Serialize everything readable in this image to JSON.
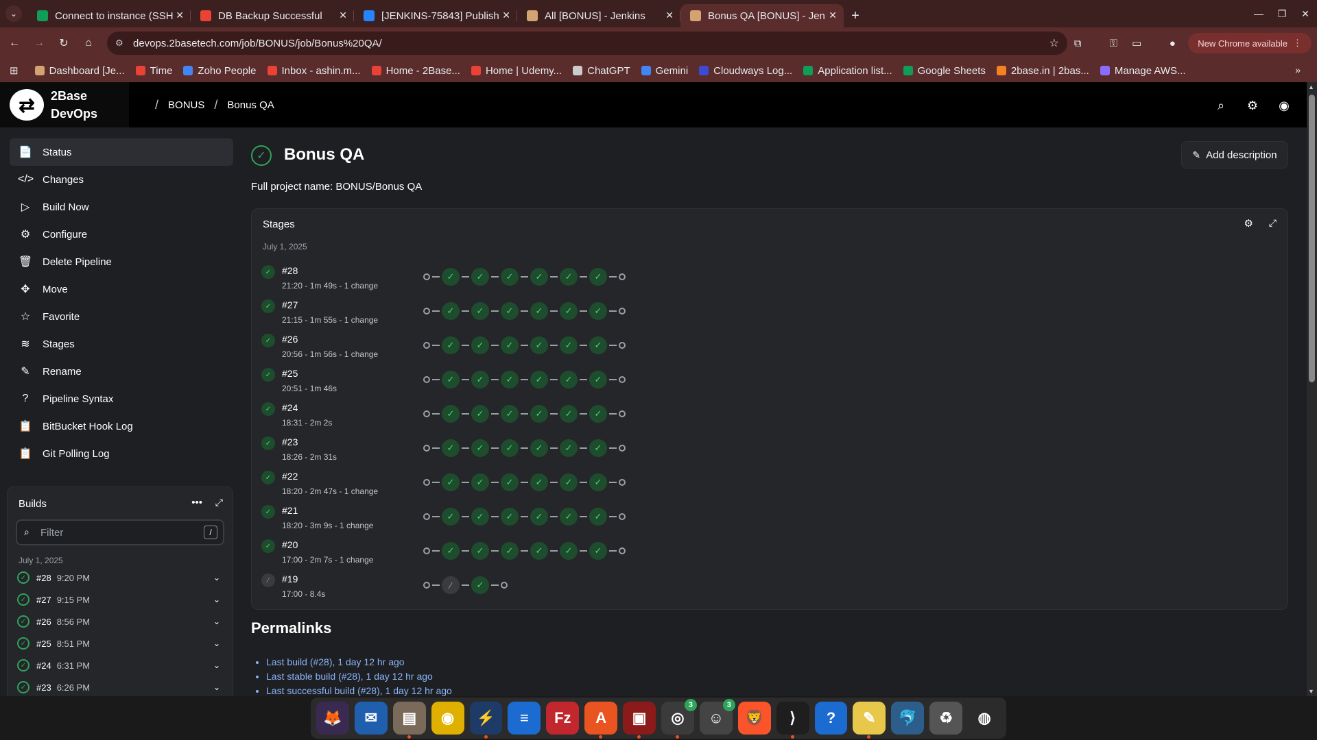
{
  "browser": {
    "tabs": [
      {
        "label": "Connect to instance (SSH",
        "color": "#0f9d58"
      },
      {
        "label": "DB Backup Successful",
        "color": "#ea4335"
      },
      {
        "label": "[JENKINS-75843] Publish",
        "color": "#2684ff"
      },
      {
        "label": "All [BONUS] - Jenkins",
        "color": "#d4a373"
      },
      {
        "label": "Bonus QA [BONUS] - Jen",
        "color": "#d4a373"
      }
    ],
    "url": "devops.2basetech.com/job/BONUS/job/Bonus%20QA/",
    "new_chrome": "New Chrome available",
    "bookmarks": [
      {
        "label": "Dashboard [Je...",
        "color": "#d4a373"
      },
      {
        "label": "Time",
        "color": "#ea4335"
      },
      {
        "label": "Zoho People",
        "color": "#4285f4"
      },
      {
        "label": "Inbox - ashin.m...",
        "color": "#ea4335"
      },
      {
        "label": "Home - 2Base...",
        "color": "#ea4335"
      },
      {
        "label": "Home | Udemy...",
        "color": "#ea4335"
      },
      {
        "label": "ChatGPT",
        "color": "#cccccc"
      },
      {
        "label": "Gemini",
        "color": "#4285f4"
      },
      {
        "label": "Cloudways Log...",
        "color": "#3c4bd6"
      },
      {
        "label": "Application list...",
        "color": "#0f9d58"
      },
      {
        "label": "Google Sheets",
        "color": "#0f9d58"
      },
      {
        "label": "2base.in | 2bas...",
        "color": "#f6821f"
      },
      {
        "label": "Manage AWS...",
        "color": "#8a6dff"
      }
    ]
  },
  "header": {
    "logo_line1": "2Base",
    "logo_line2": "DevOps",
    "breadcrumb": [
      "BONUS",
      "Bonus QA"
    ]
  },
  "sidebar": {
    "items": [
      {
        "label": "Status",
        "icon": "📄"
      },
      {
        "label": "Changes",
        "icon": "</>"
      },
      {
        "label": "Build Now",
        "icon": "▷"
      },
      {
        "label": "Configure",
        "icon": "⚙"
      },
      {
        "label": "Delete Pipeline",
        "icon": "🗑"
      },
      {
        "label": "Move",
        "icon": "✥"
      },
      {
        "label": "Favorite",
        "icon": "☆"
      },
      {
        "label": "Stages",
        "icon": "≋"
      },
      {
        "label": "Rename",
        "icon": "✎"
      },
      {
        "label": "Pipeline Syntax",
        "icon": "?"
      },
      {
        "label": "BitBucket Hook Log",
        "icon": "📋"
      },
      {
        "label": "Git Polling Log",
        "icon": "📋"
      }
    ]
  },
  "builds": {
    "title": "Builds",
    "filter_placeholder": "Filter",
    "filter_shortcut": "/",
    "date": "July 1, 2025",
    "rows": [
      {
        "num": "#28",
        "time": "9:20 PM"
      },
      {
        "num": "#27",
        "time": "9:15 PM"
      },
      {
        "num": "#26",
        "time": "8:56 PM"
      },
      {
        "num": "#25",
        "time": "8:51 PM"
      },
      {
        "num": "#24",
        "time": "6:31 PM"
      },
      {
        "num": "#23",
        "time": "6:26 PM"
      }
    ]
  },
  "content": {
    "title": "Bonus QA",
    "add_description": "Add description",
    "full_name": "Full project name: BONUS/Bonus QA",
    "stages_title": "Stages",
    "stages_date": "July 1, 2025",
    "runs": [
      {
        "num": "#28",
        "meta": "21:20 - 1m 49s - 1 change"
      },
      {
        "num": "#27",
        "meta": "21:15 - 1m 55s - 1 change"
      },
      {
        "num": "#26",
        "meta": "20:56 - 1m 56s - 1 change"
      },
      {
        "num": "#25",
        "meta": "20:51 - 1m 46s"
      },
      {
        "num": "#24",
        "meta": "18:31 - 2m 2s"
      },
      {
        "num": "#23",
        "meta": "18:26 - 2m 31s"
      },
      {
        "num": "#22",
        "meta": "18:20 - 2m 47s - 1 change"
      },
      {
        "num": "#21",
        "meta": "18:20 - 3m 9s - 1 change"
      },
      {
        "num": "#20",
        "meta": "17:00 - 2m 7s - 1 change"
      },
      {
        "num": "#19",
        "meta": "17:00 - 8.4s"
      }
    ],
    "permalinks_title": "Permalinks",
    "permalinks": [
      "Last build (#28), 1 day 12 hr ago",
      "Last stable build (#28), 1 day 12 hr ago",
      "Last successful build (#28), 1 day 12 hr ago"
    ]
  },
  "dock": [
    {
      "name": "firefox-icon",
      "glyph": "🦊",
      "bg": "#3a2a52"
    },
    {
      "name": "thunderbird-icon",
      "glyph": "✉",
      "bg": "#1f5fae"
    },
    {
      "name": "files-icon",
      "glyph": "▤",
      "bg": "#7a6a5a"
    },
    {
      "name": "rhythmbox-icon",
      "glyph": "◉",
      "bg": "#e0b000"
    },
    {
      "name": "remmina-icon",
      "glyph": "⚡",
      "bg": "#1d3b66"
    },
    {
      "name": "writer-icon",
      "glyph": "≡",
      "bg": "#1c6bd0"
    },
    {
      "name": "filezilla-icon",
      "glyph": "Fz",
      "bg": "#c1272d"
    },
    {
      "name": "app-center-icon",
      "glyph": "A",
      "bg": "#e95420"
    },
    {
      "name": "screen-recorder-icon",
      "glyph": "▣",
      "bg": "#8b1a1a"
    },
    {
      "name": "chrome-icon",
      "glyph": "◎",
      "bg": "#3b3b3b",
      "badge": "3"
    },
    {
      "name": "chat-app-icon",
      "glyph": "☺",
      "bg": "#444444",
      "badge": "3"
    },
    {
      "name": "brave-icon",
      "glyph": "🦁",
      "bg": "#fb542b"
    },
    {
      "name": "vscode-icon",
      "glyph": "⟩",
      "bg": "#1e1e1e"
    },
    {
      "name": "help-icon",
      "glyph": "?",
      "bg": "#1c6bd0"
    },
    {
      "name": "text-editor-icon",
      "glyph": "✎",
      "bg": "#e8c84a"
    },
    {
      "name": "mysql-workbench-icon",
      "glyph": "🐬",
      "bg": "#2d5d8a"
    },
    {
      "name": "trash-icon",
      "glyph": "♻",
      "bg": "#555555"
    },
    {
      "name": "ubuntu-icon",
      "glyph": "◍",
      "bg": "#2b2b2b"
    }
  ]
}
